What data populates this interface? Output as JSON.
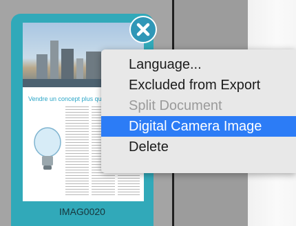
{
  "page_thumbnail": {
    "headline": "Vendre un concept plus qu'un produit",
    "caption": "IMAG0020"
  },
  "context_menu": {
    "items": [
      {
        "label": "Language...",
        "state": "normal"
      },
      {
        "label": "Excluded from Export",
        "state": "normal"
      },
      {
        "label": "Split Document",
        "state": "disabled"
      },
      {
        "label": "Digital Camera Image",
        "state": "selected"
      },
      {
        "label": "Delete",
        "state": "normal"
      }
    ]
  },
  "colors": {
    "card": "#31a9b9",
    "selection": "#2c7cf6",
    "menu_background": "#e8e8e8",
    "disabled_text": "#9a9a9a"
  },
  "icons": {
    "delete_badge": "close-circle-icon",
    "bulb": "light-bulb-icon"
  }
}
